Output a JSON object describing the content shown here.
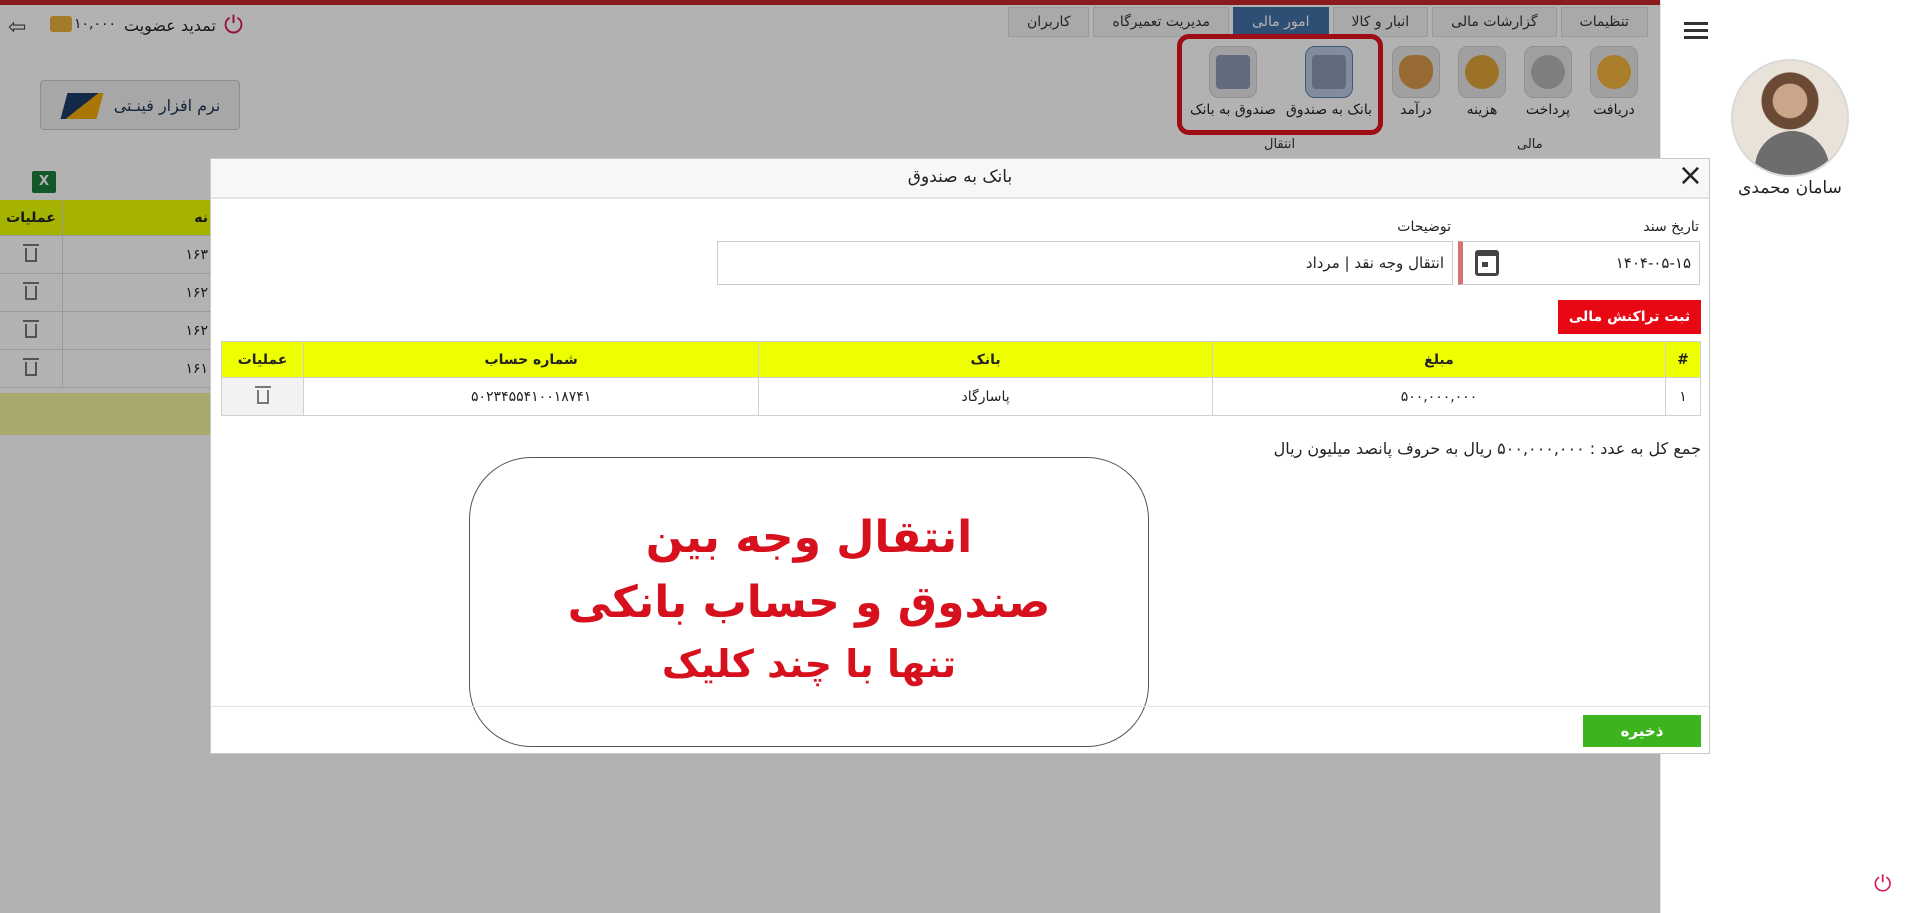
{
  "header": {
    "credit": "۱۰,۰۰۰",
    "renew_label": "تمدید عضویت"
  },
  "tabs": [
    "کاربران",
    "مدیریت تعمیرگاه",
    "امور مالی",
    "انبار و کالا",
    "گزارشات مالی",
    "تنظیمات"
  ],
  "active_tab": "امور مالی",
  "ribbon": {
    "buttons": [
      "دریافت",
      "پرداخت",
      "هزینه",
      "درآمد",
      "بانک به صندوق",
      "صندوق به بانک"
    ],
    "groups": {
      "finance": "مالی",
      "transfer": "انتقال"
    }
  },
  "logo_text": "نرم افزار فینـتی",
  "user": {
    "name": "سامان محمدی"
  },
  "background_table": {
    "headers": [
      "عملیات",
      "نه"
    ],
    "rows": [
      "۱۶۳",
      "۱۶۲",
      "۱۶۲",
      "۱۶۱"
    ]
  },
  "modal": {
    "title": "بانک به صندوق",
    "date_label": "تاریخ سند",
    "date_value": "۱۴۰۴-۰۵-۱۵",
    "desc_label": "توضیحات",
    "desc_value": "انتقال وجه نقد | مرداد",
    "register_button": "ثبت تراکنش مالی",
    "table": {
      "headers": {
        "num": "#",
        "amount": "مبلغ",
        "bank": "بانک",
        "account": "شماره حساب",
        "ops": "عملیات"
      },
      "rows": [
        {
          "num": "۱",
          "amount": "۵۰۰,۰۰۰,۰۰۰",
          "bank": "پاسارگاد",
          "account": "۵۰۲۳۴۵۵۴۱۰۰۱۸۷۴۱"
        }
      ]
    },
    "total_text": "جمع کل به عدد : ۵۰۰,۰۰۰,۰۰۰ ریال به حروف پانصد میلیون ریال",
    "save_button": "ذخیره"
  },
  "callout": {
    "line1": "انتقال وجه بین",
    "line2": "صندوق و حساب بانکی",
    "line3": "تنها با چند کلیک"
  },
  "colors": {
    "accent_red": "#e80813",
    "tab_active": "#4470a6",
    "table_header": "#eeff00",
    "save_green": "#3db41e",
    "callout_text": "#d7101d"
  }
}
